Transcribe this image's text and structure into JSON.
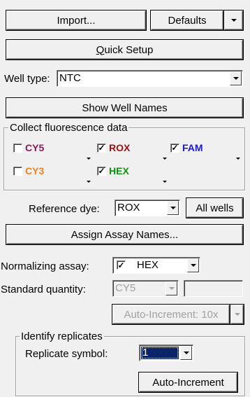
{
  "buttons": {
    "import": "Import...",
    "defaults": "Defaults",
    "quick_setup_prefix": "",
    "quick_setup_mnemonic": "Q",
    "quick_setup_rest": "uick Setup",
    "show_well_names": "Show Well Names",
    "all_wells": "All wells",
    "assign_assay_names": "Assign Assay Names...",
    "auto_increment_disabled": "Auto-Increment: 10x",
    "auto_increment": "Auto-Increment"
  },
  "well_type": {
    "label": "Well type:",
    "value": "NTC"
  },
  "fluorescence": {
    "legend": "Collect fluorescence data",
    "dyes": [
      {
        "name": "CY5",
        "checked": false,
        "color": "#8b1a5a"
      },
      {
        "name": "ROX",
        "checked": true,
        "color": "#a01010"
      },
      {
        "name": "FAM",
        "checked": true,
        "color": "#1a1ad0"
      },
      {
        "name": "CY3",
        "checked": false,
        "color": "#f08020"
      },
      {
        "name": "HEX",
        "checked": true,
        "color": "#109010"
      }
    ]
  },
  "reference_dye": {
    "label": "Reference dye:",
    "value": "ROX"
  },
  "normalizing_assay": {
    "label": "Normalizing assay:",
    "value": "HEX",
    "checked": true
  },
  "standard_quantity": {
    "label": "Standard quantity:",
    "value": "CY5",
    "input": ""
  },
  "replicates": {
    "legend": "Identify replicates",
    "symbol_label": "Replicate symbol:",
    "symbol_value": "1",
    "symbol_color": "#0a246a"
  },
  "check_glyph": "✓"
}
